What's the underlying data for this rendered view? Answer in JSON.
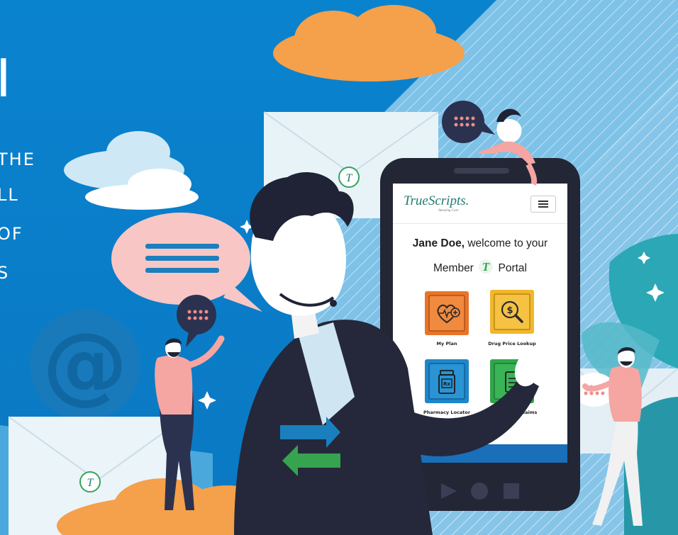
{
  "hero": {
    "letter": "I",
    "lines": [
      "THE",
      "LL",
      "OF",
      "S"
    ]
  },
  "app": {
    "brand": "TrueScripts.",
    "tagline": "Amazing Care",
    "welcome_name": "Jane Doe,",
    "welcome_rest": " welcome to your",
    "portal_before": "Member",
    "portal_after": "Portal",
    "tiles": [
      {
        "label": "My Plan",
        "icon": "heart-plus-icon",
        "color": "#e8742a"
      },
      {
        "label": "Drug Price Lookup",
        "icon": "magnifier-dollar-icon",
        "color": "#f1b62b"
      },
      {
        "label": "Pharmacy Locator",
        "icon": "pill-bottle-icon",
        "color": "#1f86c9"
      },
      {
        "label": "y Claims",
        "icon": "clipboard-icon",
        "color": "#2fa64b"
      }
    ]
  },
  "colors": {
    "sky": "#0a7fc9",
    "orange": "#f5a04a",
    "phone": "#232635",
    "brand": "#1f7a6c",
    "accent_blue": "#1a6fb9"
  }
}
